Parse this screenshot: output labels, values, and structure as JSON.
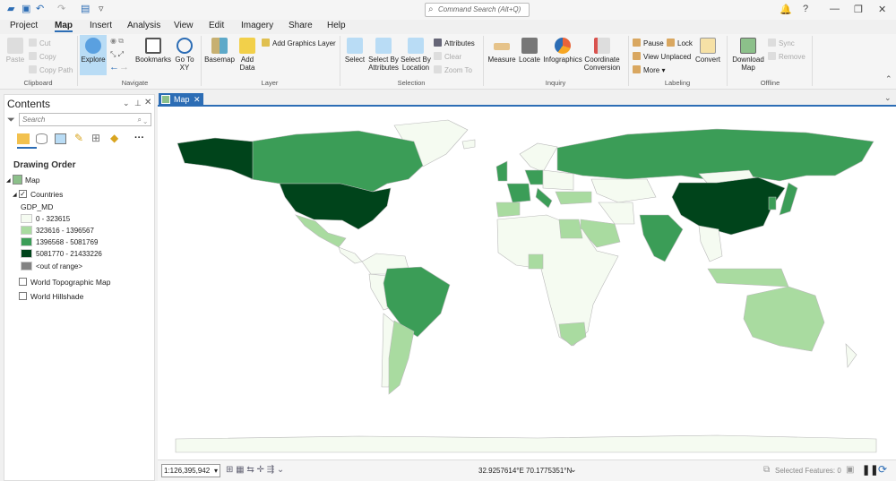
{
  "titlebar": {
    "command_search_placeholder": "Command Search (Alt+Q)",
    "help": "?"
  },
  "tabs": [
    "Project",
    "Map",
    "Insert",
    "Analysis",
    "View",
    "Edit",
    "Imagery",
    "Share",
    "Help"
  ],
  "active_tab": "Map",
  "ribbon": {
    "clipboard": {
      "label": "Clipboard",
      "paste": "Paste",
      "cut": "Cut",
      "copy": "Copy",
      "copy_path": "Copy Path"
    },
    "navigate": {
      "label": "Navigate",
      "explore": "Explore",
      "bookmarks": "Bookmarks",
      "go_to_xy": "Go To XY"
    },
    "layer": {
      "label": "Layer",
      "basemap": "Basemap",
      "add_data": "Add Data",
      "add_graphics_layer": "Add Graphics Layer"
    },
    "selection": {
      "label": "Selection",
      "select": "Select",
      "select_by_attributes": "Select By Attributes",
      "select_by_location": "Select By Location",
      "attributes": "Attributes",
      "clear": "Clear",
      "zoom_to": "Zoom To"
    },
    "inquiry": {
      "label": "Inquiry",
      "measure": "Measure",
      "locate": "Locate",
      "infographics": "Infographics",
      "coordinate_conversion": "Coordinate Conversion"
    },
    "labeling": {
      "label": "Labeling",
      "pause": "Pause",
      "lock": "Lock",
      "view_unplaced": "View Unplaced",
      "more": "More",
      "convert": "Convert"
    },
    "offline": {
      "label": "Offline",
      "download_map": "Download Map",
      "sync": "Sync",
      "remove": "Remove"
    }
  },
  "contents": {
    "title": "Contents",
    "search_placeholder": "Search",
    "drawing_order": "Drawing Order",
    "map_item": "Map",
    "layer": "Countries",
    "field": "GDP_MD",
    "legend": [
      {
        "label": "0 - 323615",
        "color": "#f5fbf1"
      },
      {
        "label": "323616 - 1396567",
        "color": "#a9dba0"
      },
      {
        "label": "1396568 - 5081769",
        "color": "#3b9d57"
      },
      {
        "label": "5081770 - 21433226",
        "color": "#00441b"
      }
    ],
    "out_of_range": {
      "label": "<out of range>",
      "color": "#828282"
    },
    "basemaps": [
      {
        "label": "World Topographic Map",
        "checked": false
      },
      {
        "label": "World Hillshade",
        "checked": false
      }
    ]
  },
  "map_tab": {
    "label": "Map"
  },
  "status": {
    "scale": "1:126,395,942",
    "coordinates": "32.9257614°E 70.1775351°N",
    "selected_features": "Selected Features: 0"
  },
  "colors": {
    "accent": "#2c6db5",
    "outline": "#b9b9b9"
  }
}
